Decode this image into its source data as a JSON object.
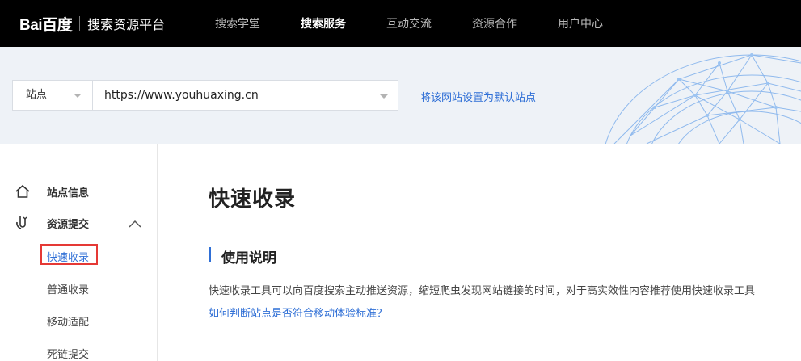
{
  "header": {
    "logo_text": "Bai百度",
    "platform_title": "搜索资源平台",
    "nav": [
      {
        "label": "搜索学堂",
        "active": false
      },
      {
        "label": "搜索服务",
        "active": true
      },
      {
        "label": "互动交流",
        "active": false
      },
      {
        "label": "资源合作",
        "active": false
      },
      {
        "label": "用户中心",
        "active": false
      }
    ]
  },
  "site_selector": {
    "type_label": "站点",
    "site_url": "https://www.youhuaxing.cn",
    "set_default_link": "将该网站设置为默认站点"
  },
  "sidebar": {
    "items": [
      {
        "label": "站点信息",
        "icon": "home-icon"
      },
      {
        "label": "资源提交",
        "icon": "upload-icon"
      }
    ],
    "sub_items": [
      {
        "label": "快速收录",
        "active": true
      },
      {
        "label": "普通收录",
        "active": false
      },
      {
        "label": "移动适配",
        "active": false
      },
      {
        "label": "死链提交",
        "active": false
      }
    ]
  },
  "main": {
    "page_title": "快速收录",
    "section_title": "使用说明",
    "description": "快速收录工具可以向百度搜索主动推送资源，缩短爬虫发现网站链接的时间，对于高实效性内容推荐使用快速收录工具",
    "help_link": "如何判断站点是否符合移动体验标准？"
  },
  "colors": {
    "accent": "#2f6fd6",
    "topbar": "#000000",
    "highlight": "#e53935"
  }
}
